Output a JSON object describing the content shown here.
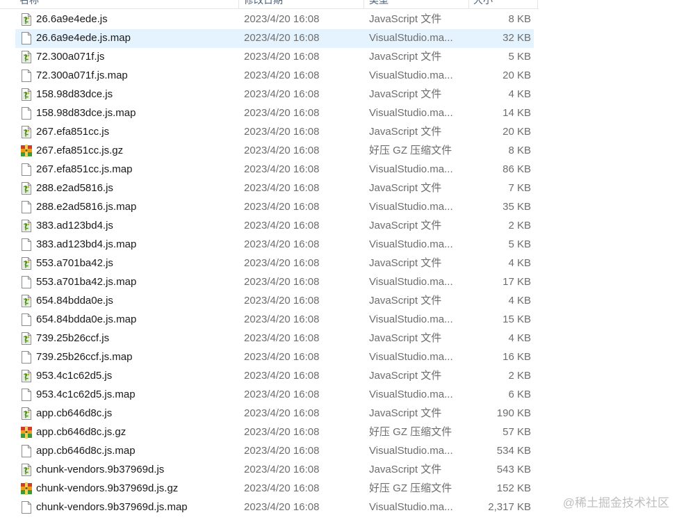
{
  "header": {
    "columns": [
      "名称",
      "修改日期",
      "类型",
      "大小"
    ]
  },
  "files": [
    {
      "name": "26.6a9e4ede.js",
      "date": "2023/4/20 16:08",
      "type": "JavaScript 文件",
      "size": "8 KB",
      "icon": "js-file-icon"
    },
    {
      "name": "26.6a9e4ede.js.map",
      "date": "2023/4/20 16:08",
      "type": "VisualStudio.ma...",
      "size": "32 KB",
      "icon": "map-file-icon"
    },
    {
      "name": "72.300a071f.js",
      "date": "2023/4/20 16:08",
      "type": "JavaScript 文件",
      "size": "5 KB",
      "icon": "js-file-icon"
    },
    {
      "name": "72.300a071f.js.map",
      "date": "2023/4/20 16:08",
      "type": "VisualStudio.ma...",
      "size": "20 KB",
      "icon": "map-file-icon"
    },
    {
      "name": "158.98d83dce.js",
      "date": "2023/4/20 16:08",
      "type": "JavaScript 文件",
      "size": "4 KB",
      "icon": "js-file-icon"
    },
    {
      "name": "158.98d83dce.js.map",
      "date": "2023/4/20 16:08",
      "type": "VisualStudio.ma...",
      "size": "14 KB",
      "icon": "map-file-icon"
    },
    {
      "name": "267.efa851cc.js",
      "date": "2023/4/20 16:08",
      "type": "JavaScript 文件",
      "size": "20 KB",
      "icon": "js-file-icon"
    },
    {
      "name": "267.efa851cc.js.gz",
      "date": "2023/4/20 16:08",
      "type": "好压 GZ 压缩文件",
      "size": "8 KB",
      "icon": "gz-archive-icon"
    },
    {
      "name": "267.efa851cc.js.map",
      "date": "2023/4/20 16:08",
      "type": "VisualStudio.ma...",
      "size": "86 KB",
      "icon": "map-file-icon"
    },
    {
      "name": "288.e2ad5816.js",
      "date": "2023/4/20 16:08",
      "type": "JavaScript 文件",
      "size": "7 KB",
      "icon": "js-file-icon"
    },
    {
      "name": "288.e2ad5816.js.map",
      "date": "2023/4/20 16:08",
      "type": "VisualStudio.ma...",
      "size": "35 KB",
      "icon": "map-file-icon"
    },
    {
      "name": "383.ad123bd4.js",
      "date": "2023/4/20 16:08",
      "type": "JavaScript 文件",
      "size": "2 KB",
      "icon": "js-file-icon"
    },
    {
      "name": "383.ad123bd4.js.map",
      "date": "2023/4/20 16:08",
      "type": "VisualStudio.ma...",
      "size": "5 KB",
      "icon": "map-file-icon"
    },
    {
      "name": "553.a701ba42.js",
      "date": "2023/4/20 16:08",
      "type": "JavaScript 文件",
      "size": "4 KB",
      "icon": "js-file-icon"
    },
    {
      "name": "553.a701ba42.js.map",
      "date": "2023/4/20 16:08",
      "type": "VisualStudio.ma...",
      "size": "17 KB",
      "icon": "map-file-icon"
    },
    {
      "name": "654.84bdda0e.js",
      "date": "2023/4/20 16:08",
      "type": "JavaScript 文件",
      "size": "4 KB",
      "icon": "js-file-icon"
    },
    {
      "name": "654.84bdda0e.js.map",
      "date": "2023/4/20 16:08",
      "type": "VisualStudio.ma...",
      "size": "15 KB",
      "icon": "map-file-icon"
    },
    {
      "name": "739.25b26ccf.js",
      "date": "2023/4/20 16:08",
      "type": "JavaScript 文件",
      "size": "4 KB",
      "icon": "js-file-icon"
    },
    {
      "name": "739.25b26ccf.js.map",
      "date": "2023/4/20 16:08",
      "type": "VisualStudio.ma...",
      "size": "16 KB",
      "icon": "map-file-icon"
    },
    {
      "name": "953.4c1c62d5.js",
      "date": "2023/4/20 16:08",
      "type": "JavaScript 文件",
      "size": "2 KB",
      "icon": "js-file-icon"
    },
    {
      "name": "953.4c1c62d5.js.map",
      "date": "2023/4/20 16:08",
      "type": "VisualStudio.ma...",
      "size": "6 KB",
      "icon": "map-file-icon"
    },
    {
      "name": "app.cb646d8c.js",
      "date": "2023/4/20 16:08",
      "type": "JavaScript 文件",
      "size": "190 KB",
      "icon": "js-file-icon"
    },
    {
      "name": "app.cb646d8c.js.gz",
      "date": "2023/4/20 16:08",
      "type": "好压 GZ 压缩文件",
      "size": "57 KB",
      "icon": "gz-archive-icon"
    },
    {
      "name": "app.cb646d8c.js.map",
      "date": "2023/4/20 16:08",
      "type": "VisualStudio.ma...",
      "size": "534 KB",
      "icon": "map-file-icon"
    },
    {
      "name": "chunk-vendors.9b37969d.js",
      "date": "2023/4/20 16:08",
      "type": "JavaScript 文件",
      "size": "543 KB",
      "icon": "js-file-icon"
    },
    {
      "name": "chunk-vendors.9b37969d.js.gz",
      "date": "2023/4/20 16:08",
      "type": "好压 GZ 压缩文件",
      "size": "152 KB",
      "icon": "gz-archive-icon"
    },
    {
      "name": "chunk-vendors.9b37969d.js.map",
      "date": "2023/4/20 16:08",
      "type": "VisualStudio.ma...",
      "size": "2,317 KB",
      "icon": "map-file-icon"
    }
  ],
  "selected_index": 1,
  "watermark": "@稀土掘金技术社区",
  "colors": {
    "selection": "#e5f3ff",
    "name_text": "#1a1a1a",
    "meta_text": "#6d6d6d"
  }
}
